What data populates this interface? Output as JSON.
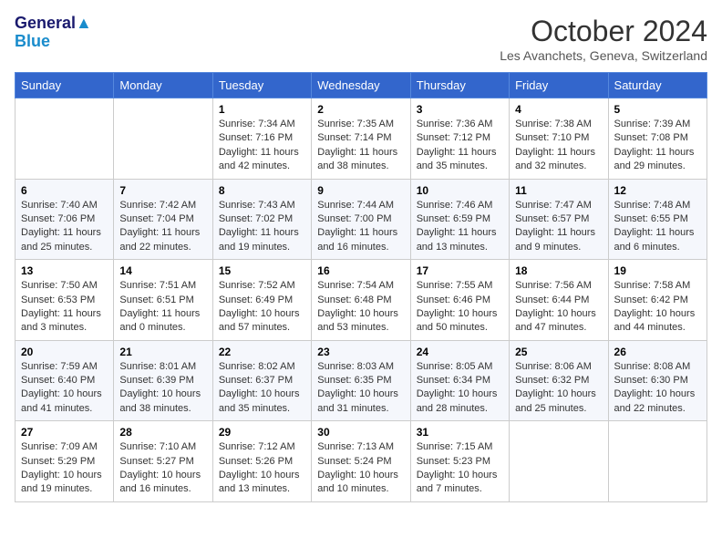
{
  "header": {
    "logo_line1": "General",
    "logo_line2": "Blue",
    "month_title": "October 2024",
    "location": "Les Avanchets, Geneva, Switzerland"
  },
  "weekdays": [
    "Sunday",
    "Monday",
    "Tuesday",
    "Wednesday",
    "Thursday",
    "Friday",
    "Saturday"
  ],
  "weeks": [
    [
      {
        "day": "",
        "sunrise": "",
        "sunset": "",
        "daylight": ""
      },
      {
        "day": "",
        "sunrise": "",
        "sunset": "",
        "daylight": ""
      },
      {
        "day": "1",
        "sunrise": "Sunrise: 7:34 AM",
        "sunset": "Sunset: 7:16 PM",
        "daylight": "Daylight: 11 hours and 42 minutes."
      },
      {
        "day": "2",
        "sunrise": "Sunrise: 7:35 AM",
        "sunset": "Sunset: 7:14 PM",
        "daylight": "Daylight: 11 hours and 38 minutes."
      },
      {
        "day": "3",
        "sunrise": "Sunrise: 7:36 AM",
        "sunset": "Sunset: 7:12 PM",
        "daylight": "Daylight: 11 hours and 35 minutes."
      },
      {
        "day": "4",
        "sunrise": "Sunrise: 7:38 AM",
        "sunset": "Sunset: 7:10 PM",
        "daylight": "Daylight: 11 hours and 32 minutes."
      },
      {
        "day": "5",
        "sunrise": "Sunrise: 7:39 AM",
        "sunset": "Sunset: 7:08 PM",
        "daylight": "Daylight: 11 hours and 29 minutes."
      }
    ],
    [
      {
        "day": "6",
        "sunrise": "Sunrise: 7:40 AM",
        "sunset": "Sunset: 7:06 PM",
        "daylight": "Daylight: 11 hours and 25 minutes."
      },
      {
        "day": "7",
        "sunrise": "Sunrise: 7:42 AM",
        "sunset": "Sunset: 7:04 PM",
        "daylight": "Daylight: 11 hours and 22 minutes."
      },
      {
        "day": "8",
        "sunrise": "Sunrise: 7:43 AM",
        "sunset": "Sunset: 7:02 PM",
        "daylight": "Daylight: 11 hours and 19 minutes."
      },
      {
        "day": "9",
        "sunrise": "Sunrise: 7:44 AM",
        "sunset": "Sunset: 7:00 PM",
        "daylight": "Daylight: 11 hours and 16 minutes."
      },
      {
        "day": "10",
        "sunrise": "Sunrise: 7:46 AM",
        "sunset": "Sunset: 6:59 PM",
        "daylight": "Daylight: 11 hours and 13 minutes."
      },
      {
        "day": "11",
        "sunrise": "Sunrise: 7:47 AM",
        "sunset": "Sunset: 6:57 PM",
        "daylight": "Daylight: 11 hours and 9 minutes."
      },
      {
        "day": "12",
        "sunrise": "Sunrise: 7:48 AM",
        "sunset": "Sunset: 6:55 PM",
        "daylight": "Daylight: 11 hours and 6 minutes."
      }
    ],
    [
      {
        "day": "13",
        "sunrise": "Sunrise: 7:50 AM",
        "sunset": "Sunset: 6:53 PM",
        "daylight": "Daylight: 11 hours and 3 minutes."
      },
      {
        "day": "14",
        "sunrise": "Sunrise: 7:51 AM",
        "sunset": "Sunset: 6:51 PM",
        "daylight": "Daylight: 11 hours and 0 minutes."
      },
      {
        "day": "15",
        "sunrise": "Sunrise: 7:52 AM",
        "sunset": "Sunset: 6:49 PM",
        "daylight": "Daylight: 10 hours and 57 minutes."
      },
      {
        "day": "16",
        "sunrise": "Sunrise: 7:54 AM",
        "sunset": "Sunset: 6:48 PM",
        "daylight": "Daylight: 10 hours and 53 minutes."
      },
      {
        "day": "17",
        "sunrise": "Sunrise: 7:55 AM",
        "sunset": "Sunset: 6:46 PM",
        "daylight": "Daylight: 10 hours and 50 minutes."
      },
      {
        "day": "18",
        "sunrise": "Sunrise: 7:56 AM",
        "sunset": "Sunset: 6:44 PM",
        "daylight": "Daylight: 10 hours and 47 minutes."
      },
      {
        "day": "19",
        "sunrise": "Sunrise: 7:58 AM",
        "sunset": "Sunset: 6:42 PM",
        "daylight": "Daylight: 10 hours and 44 minutes."
      }
    ],
    [
      {
        "day": "20",
        "sunrise": "Sunrise: 7:59 AM",
        "sunset": "Sunset: 6:40 PM",
        "daylight": "Daylight: 10 hours and 41 minutes."
      },
      {
        "day": "21",
        "sunrise": "Sunrise: 8:01 AM",
        "sunset": "Sunset: 6:39 PM",
        "daylight": "Daylight: 10 hours and 38 minutes."
      },
      {
        "day": "22",
        "sunrise": "Sunrise: 8:02 AM",
        "sunset": "Sunset: 6:37 PM",
        "daylight": "Daylight: 10 hours and 35 minutes."
      },
      {
        "day": "23",
        "sunrise": "Sunrise: 8:03 AM",
        "sunset": "Sunset: 6:35 PM",
        "daylight": "Daylight: 10 hours and 31 minutes."
      },
      {
        "day": "24",
        "sunrise": "Sunrise: 8:05 AM",
        "sunset": "Sunset: 6:34 PM",
        "daylight": "Daylight: 10 hours and 28 minutes."
      },
      {
        "day": "25",
        "sunrise": "Sunrise: 8:06 AM",
        "sunset": "Sunset: 6:32 PM",
        "daylight": "Daylight: 10 hours and 25 minutes."
      },
      {
        "day": "26",
        "sunrise": "Sunrise: 8:08 AM",
        "sunset": "Sunset: 6:30 PM",
        "daylight": "Daylight: 10 hours and 22 minutes."
      }
    ],
    [
      {
        "day": "27",
        "sunrise": "Sunrise: 7:09 AM",
        "sunset": "Sunset: 5:29 PM",
        "daylight": "Daylight: 10 hours and 19 minutes."
      },
      {
        "day": "28",
        "sunrise": "Sunrise: 7:10 AM",
        "sunset": "Sunset: 5:27 PM",
        "daylight": "Daylight: 10 hours and 16 minutes."
      },
      {
        "day": "29",
        "sunrise": "Sunrise: 7:12 AM",
        "sunset": "Sunset: 5:26 PM",
        "daylight": "Daylight: 10 hours and 13 minutes."
      },
      {
        "day": "30",
        "sunrise": "Sunrise: 7:13 AM",
        "sunset": "Sunset: 5:24 PM",
        "daylight": "Daylight: 10 hours and 10 minutes."
      },
      {
        "day": "31",
        "sunrise": "Sunrise: 7:15 AM",
        "sunset": "Sunset: 5:23 PM",
        "daylight": "Daylight: 10 hours and 7 minutes."
      },
      {
        "day": "",
        "sunrise": "",
        "sunset": "",
        "daylight": ""
      },
      {
        "day": "",
        "sunrise": "",
        "sunset": "",
        "daylight": ""
      }
    ]
  ]
}
